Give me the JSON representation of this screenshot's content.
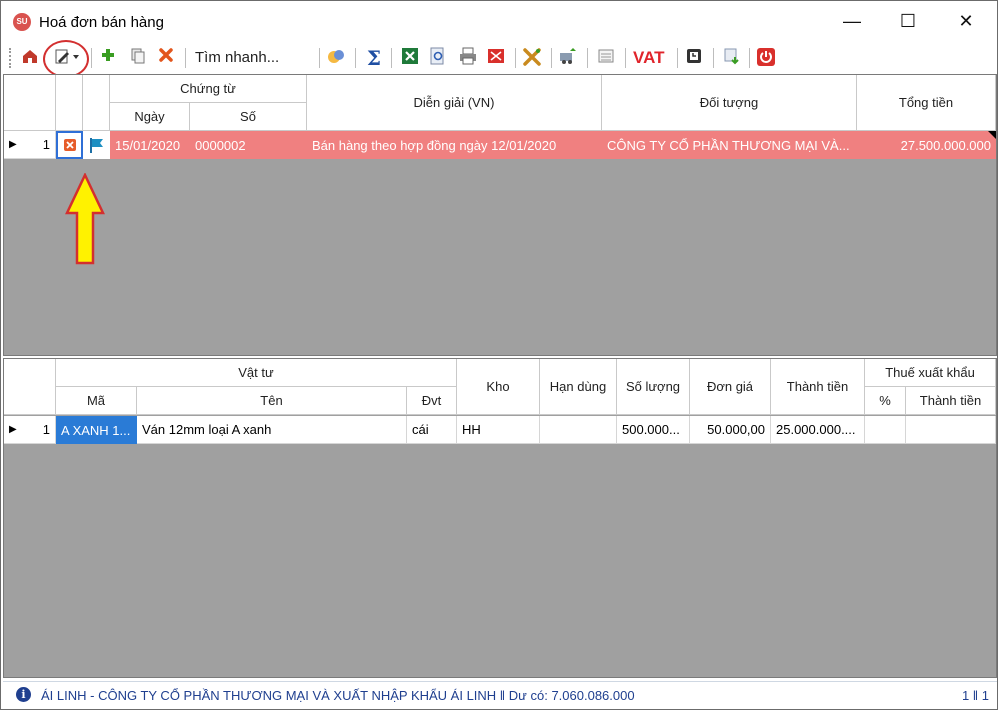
{
  "window": {
    "title": "Hoá đơn bán hàng",
    "app_icon_text": "SU",
    "minimize": "—",
    "maximize": "☐",
    "close": "✕"
  },
  "toolbar": {
    "search_label": "Tìm nhanh...",
    "vat_label": "VAT",
    "icons": [
      "home-icon",
      "edit-document-icon",
      "add-icon",
      "copy-icon",
      "delete-icon",
      "filter-icon",
      "sum-icon",
      "excel-icon",
      "preview-icon",
      "print-icon",
      "email-icon",
      "tools-icon",
      "transfer-icon",
      "calculator-icon",
      "calendar-icon",
      "export-icon",
      "power-icon"
    ]
  },
  "top_grid": {
    "headers": {
      "chung_tu": "Chứng từ",
      "ngay": "Ngày",
      "so": "Số",
      "dien_giai": "Diễn giải (VN)",
      "doi_tuong": "Đối tượng",
      "tong_tien": "Tổng tiền"
    },
    "row": {
      "index": "1",
      "ngay": "15/01/2020",
      "so": "0000002",
      "dien_giai": "Bán hàng theo hợp đồng ngày 12/01/2020",
      "doi_tuong": "CÔNG TY CỔ PHẦN THƯƠNG MẠI VÀ...",
      "tong_tien": "27.500.000.000"
    }
  },
  "bottom_grid": {
    "headers": {
      "vat_tu": "Vật tư",
      "ma": "Mã",
      "ten": "Tên",
      "dvt": "Đvt",
      "kho": "Kho",
      "han_dung": "Hạn dùng",
      "so_luong": "Số lượng",
      "don_gia": "Đơn giá",
      "thanh_tien": "Thành tiền",
      "thue_xuat_khau": "Thuế xuất khẩu",
      "phan_tram": "%",
      "thanh_tien_thue": "Thành tiền"
    },
    "row": {
      "index": "1",
      "ma": "A XANH 1...",
      "ten": "Ván 12mm loại A xanh",
      "dvt": "cái",
      "kho": "HH",
      "han_dung": "",
      "so_luong": "500.000...",
      "don_gia": "50.000,00",
      "thanh_tien": "25.000.000....",
      "phan_tram": "",
      "thanh_tien_thue": ""
    }
  },
  "status": {
    "text": "ÁI LINH - CÔNG TY CỔ PHẦN THƯƠNG MẠI VÀ XUẤT NHẬP KHẨU ÁI LINH ‖ Dư có: 7.060.086.000",
    "page": "1 ‖ 1"
  },
  "colors": {
    "selected_row": "#f08080",
    "grid_bg": "#a0a0a0",
    "status_text": "#1f3f8f",
    "annotation_red": "#d32f2f",
    "annotation_yellow": "#fff200"
  }
}
